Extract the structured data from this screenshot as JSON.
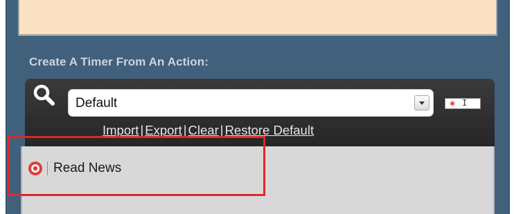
{
  "section": {
    "heading": "Create A Timer From An Action:"
  },
  "search": {
    "icon": "magnifier-icon",
    "selected_value": "Default"
  },
  "links": [
    {
      "label": "Import"
    },
    {
      "label": "Export"
    },
    {
      "label": "Clear"
    },
    {
      "label": "Restore Default"
    }
  ],
  "separator": "|",
  "list": {
    "items": [
      {
        "label": "Read News",
        "icon": "target-icon"
      }
    ]
  },
  "colors": {
    "panel": "#41607c",
    "peach": "#fbe2c4",
    "toolbar": "#2e2e2e",
    "list_bg": "#d8d8d8",
    "highlight": "#e0262c",
    "target_red": "#e13a3a"
  }
}
